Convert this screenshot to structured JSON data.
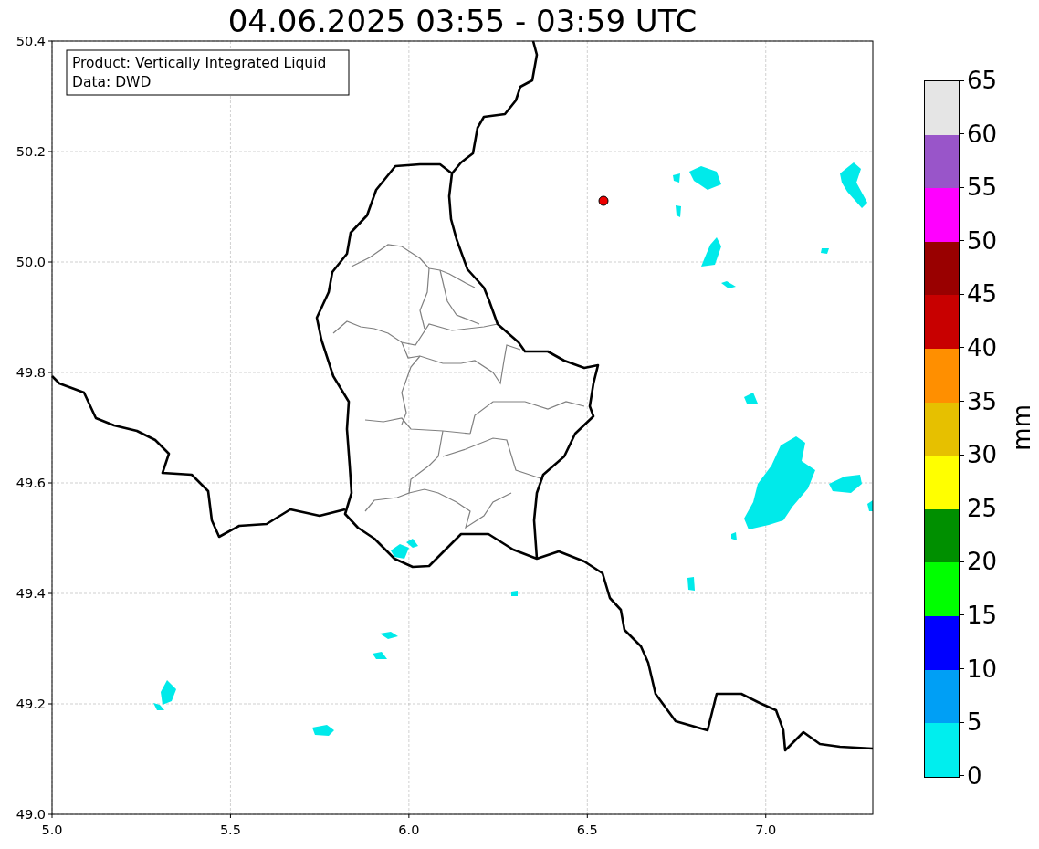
{
  "title": "04.06.2025 03:55 - 03:59 UTC",
  "legend": {
    "lines": [
      "Product: Vertically Integrated Liquid",
      "Data: DWD"
    ]
  },
  "axes": {
    "yticks": [
      "50.4",
      "50.2",
      "50.0",
      "49.8",
      "49.6",
      "49.4",
      "49.2",
      "49.0"
    ],
    "xticks": [
      "5.0",
      "5.5",
      "6.0",
      "6.5",
      "7.0"
    ]
  },
  "colorbar": {
    "label": "mm",
    "ticks": [
      "65",
      "60",
      "55",
      "50",
      "45",
      "40",
      "35",
      "30",
      "25",
      "20",
      "15",
      "10",
      "5",
      "0"
    ],
    "bins": [
      {
        "color": "#e5e5e5"
      },
      {
        "color": "#9955c9"
      },
      {
        "color": "#ff00ff"
      },
      {
        "color": "#990000"
      },
      {
        "color": "#c80000"
      },
      {
        "color": "#ff8f00"
      },
      {
        "color": "#e6c000"
      },
      {
        "color": "#ffff00"
      },
      {
        "color": "#008f00"
      },
      {
        "color": "#00ff00"
      },
      {
        "color": "#0000ff"
      },
      {
        "color": "#009ff5"
      },
      {
        "color": "#00eeee"
      }
    ]
  }
}
